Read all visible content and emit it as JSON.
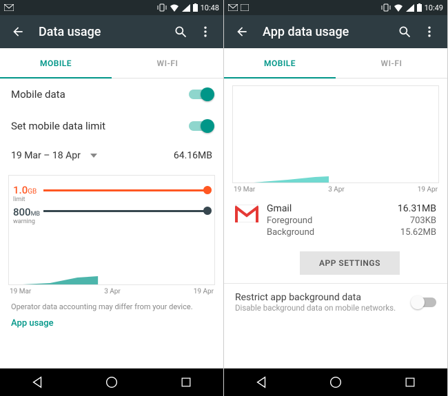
{
  "left": {
    "status_time": "10:48",
    "appbar_title": "Data usage",
    "tabs": {
      "mobile": "MOBILE",
      "wifi": "WI-FI"
    },
    "mobile_data_label": "Mobile data",
    "set_limit_label": "Set mobile data limit",
    "date_range": "19 Mar – 18 Apr",
    "total_usage": "64.16MB",
    "limit_value": "1.0",
    "limit_unit": "GB",
    "limit_caption": "limit",
    "warning_value": "800",
    "warning_unit": "MB",
    "warning_caption": "warning",
    "xaxis": {
      "a": "19 Mar",
      "b": "3 Apr",
      "c": "19 Apr"
    },
    "footer_note": "Operator data accounting may differ from your device.",
    "app_usage_link": "App usage"
  },
  "right": {
    "status_time": "10:49",
    "appbar_title": "App data usage",
    "tabs": {
      "mobile": "MOBILE",
      "wifi": "WI-FI"
    },
    "xaxis": {
      "a": "19 Mar",
      "b": "3 Apr",
      "c": "19 Apr"
    },
    "app_name": "Gmail",
    "app_total": "16.31MB",
    "fg_label": "Foreground",
    "fg_value": "703KB",
    "bg_label": "Background",
    "bg_value": "15.62MB",
    "app_settings_btn": "APP SETTINGS",
    "restrict_title": "Restrict app background data",
    "restrict_subtitle": "Disable background data on mobile networks."
  },
  "chart_data": [
    {
      "type": "area",
      "title": "Mobile data usage",
      "x": [
        "19 Mar",
        "3 Apr",
        "19 Apr"
      ],
      "series": [
        {
          "name": "usage_MB",
          "values": [
            0,
            64.16,
            64.16
          ]
        }
      ],
      "thresholds": {
        "limit_GB": 1.0,
        "warning_MB": 800
      },
      "ylim_MB": [
        0,
        1024
      ],
      "total_MB": 64.16
    },
    {
      "type": "area",
      "title": "Gmail data usage",
      "x": [
        "19 Mar",
        "3 Apr",
        "19 Apr"
      ],
      "series": [
        {
          "name": "usage_MB",
          "values": [
            0,
            16.31,
            16.31
          ]
        }
      ],
      "ylim_MB": [
        0,
        20
      ],
      "total_MB": 16.31
    }
  ]
}
